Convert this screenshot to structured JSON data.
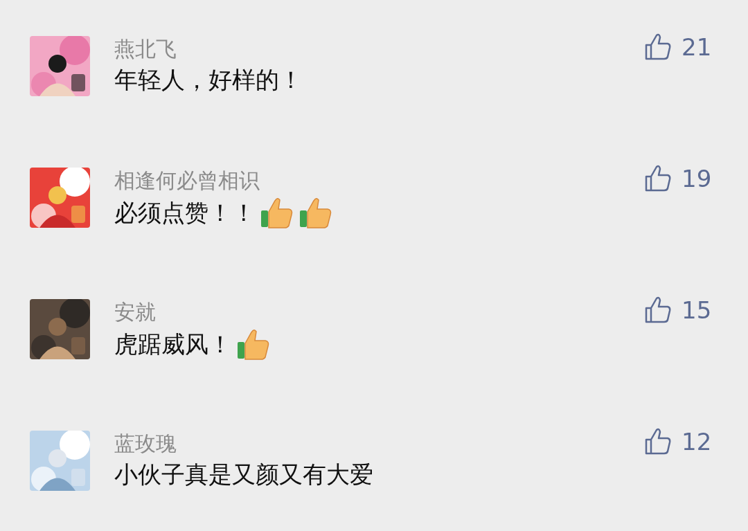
{
  "comments": [
    {
      "name": "燕北飞",
      "text": "年轻人，好样的！",
      "likes": "21",
      "avatar": {
        "kind": "picture"
      }
    },
    {
      "name": "相逢何必曾相识",
      "text": "必须点赞！！",
      "emojis": [
        {
          "kind": "thumbs-up"
        },
        {
          "kind": "thumbs-up"
        }
      ],
      "likes": "19",
      "avatar": {
        "kind": "picture"
      }
    },
    {
      "name": "安就",
      "text": "虎踞威风！",
      "emojis": [
        {
          "kind": "thumbs-up"
        }
      ],
      "likes": "15",
      "avatar": {
        "kind": "picture"
      }
    },
    {
      "name": "蓝玫瑰",
      "text": "小伙子真是又颜又有大爱",
      "likes": "12",
      "avatar": {
        "kind": "picture"
      }
    }
  ]
}
